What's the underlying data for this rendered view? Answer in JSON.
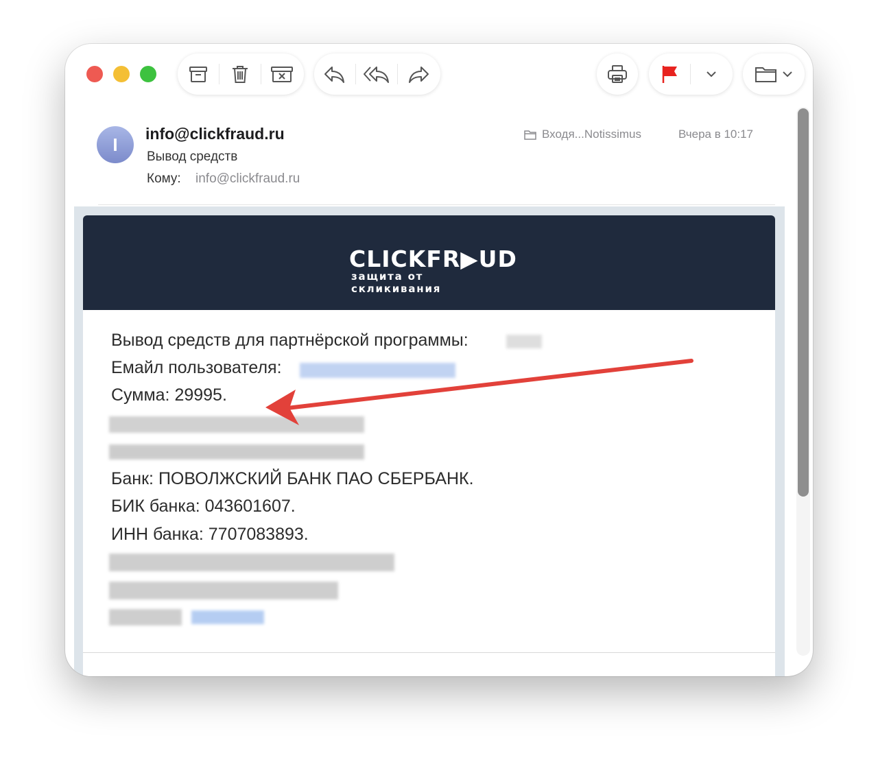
{
  "toolbar": {
    "archive_icon": "archive-icon",
    "trash_icon": "trash-icon",
    "junk_icon": "junk-icon",
    "reply_icon": "reply-icon",
    "reply_all_icon": "reply-all-icon",
    "forward_icon": "forward-icon",
    "print_icon": "print-icon",
    "flag_icon": "flag-icon",
    "flag_color": "#e8231f",
    "move_icon": "folder-icon"
  },
  "message": {
    "avatar_letter": "I",
    "from": "info@clickfraud.ru",
    "subject": "Вывод средств",
    "to_label": "Кому:",
    "to_value": "info@clickfraud.ru",
    "mailbox": "Входя...Notissimus",
    "date": "Вчера в 10:17"
  },
  "email_body": {
    "logo_text": "CLICKFR▶UD",
    "logo_subtitle": "защита от скликивания",
    "line_partner": "Вывод средств для партнёрской программы:",
    "line_email": "Емайл пользователя:",
    "line_amount": "Сумма: 29995.",
    "line_bank": "Банк: ПОВОЛЖСКИЙ БАНК ПАО СБЕРБАНК.",
    "line_bik": "БИК банка: 043601607.",
    "line_inn": "ИНН банка: 7707083893."
  },
  "colors": {
    "banner": "#1f2a3d",
    "arrow": "#e2413a",
    "accent_teal": "#2ec4c0"
  }
}
